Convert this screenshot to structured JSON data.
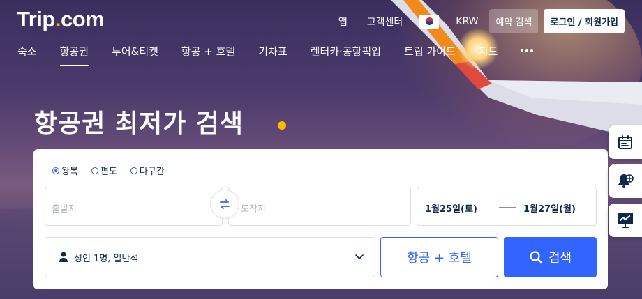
{
  "brand": {
    "logo_main": "Trip",
    "logo_dot": ".",
    "logo_tail": "com"
  },
  "topnav": {
    "app": "앱",
    "support": "고객센터",
    "flag_icon": "korea-flag-icon",
    "currency": "KRW",
    "reservation_search": "예약 검색",
    "login": "로그인 / 회원가입"
  },
  "mainnav": {
    "items": [
      {
        "label": "숙소",
        "active": false
      },
      {
        "label": "항공권",
        "active": true
      },
      {
        "label": "투어&티켓",
        "active": false
      },
      {
        "label": "항공 + 호텔",
        "active": false
      },
      {
        "label": "기차표",
        "active": false
      },
      {
        "label": "렌터카·공항픽업",
        "active": false
      },
      {
        "label": "트립 가이드",
        "active": false
      },
      {
        "label": "지도",
        "active": false
      }
    ],
    "more_icon": "more-dots-icon"
  },
  "hero": {
    "headline": "항공권 최저가 검색"
  },
  "search": {
    "trip_types": [
      {
        "label": "왕복",
        "selected": true
      },
      {
        "label": "편도",
        "selected": false
      },
      {
        "label": "다구간",
        "selected": false
      }
    ],
    "origin_placeholder": "출발지",
    "destination_placeholder": "도착지",
    "depart_date": "1월25일(토)",
    "return_date": "1월27일(월)",
    "passengers": "성인 1명, 일반석",
    "flight_hotel_button": "항공 + 호텔",
    "search_button": "검색"
  },
  "colors": {
    "accent": "#3264ff",
    "brand_dot": "#ffb900",
    "text_dark": "#0f294d"
  }
}
